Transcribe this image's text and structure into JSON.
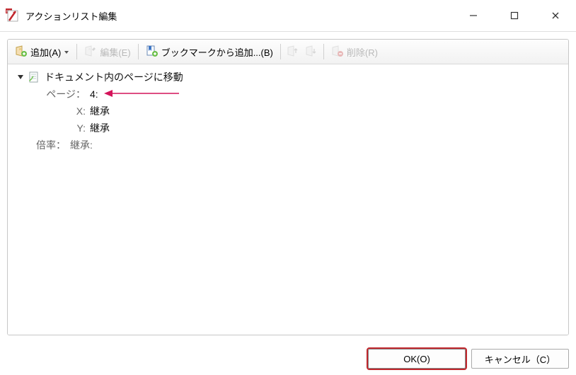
{
  "window": {
    "title": "アクションリスト編集"
  },
  "toolbar": {
    "add": "追加(A)",
    "edit": "編集(E)",
    "add_from_bookmark": "ブックマークから追加...(B)",
    "delete": "削除(R)"
  },
  "action": {
    "header": "ドキュメント内のページに移動",
    "rows": {
      "page_label": "ページ：",
      "page_value": "4:",
      "x_label": "X:",
      "x_value": "継承",
      "y_label": "Y:",
      "y_value": "継承",
      "zoom_label": "倍率：",
      "zoom_value": "継承:"
    }
  },
  "buttons": {
    "ok": "OK(O)",
    "cancel": "キャンセル（C）"
  }
}
